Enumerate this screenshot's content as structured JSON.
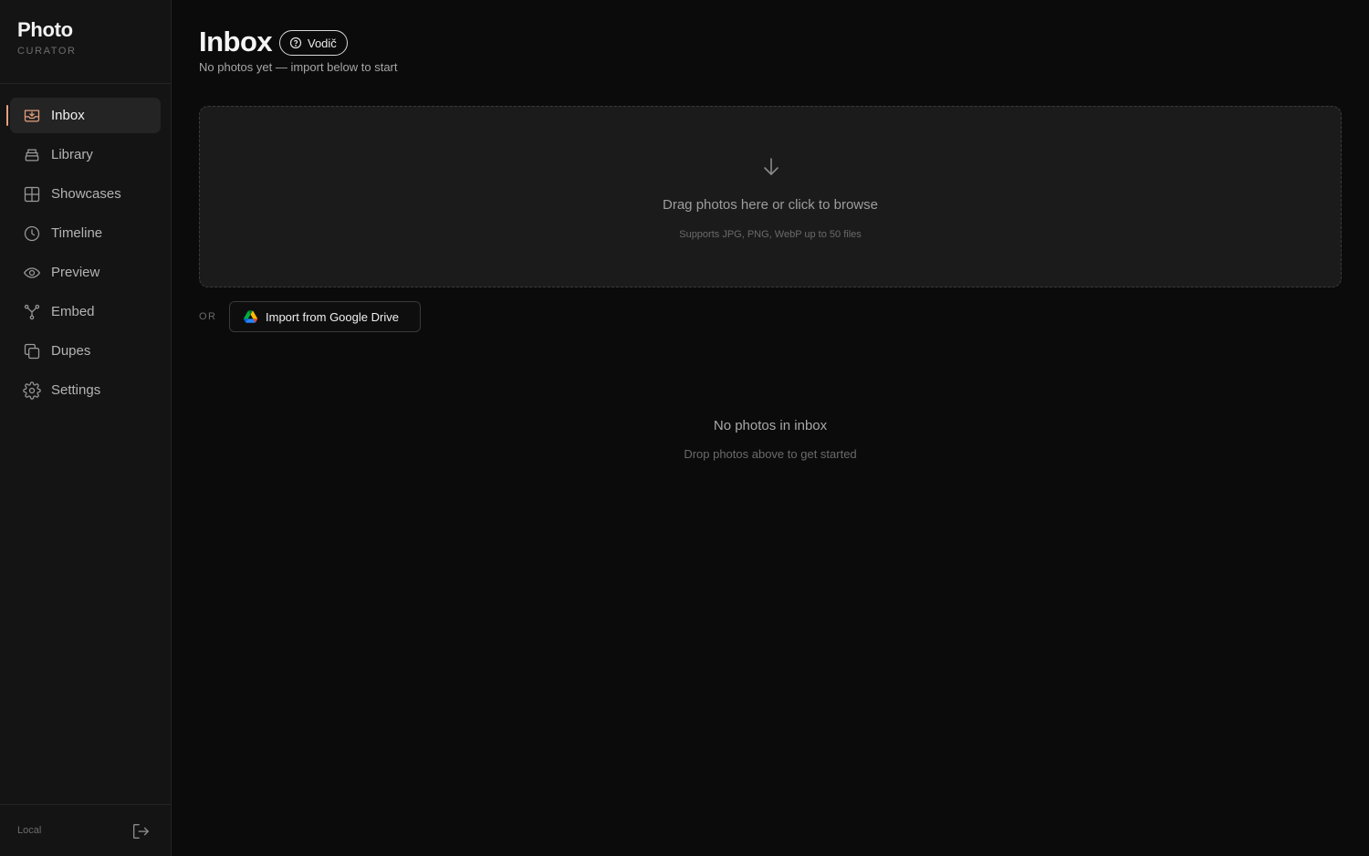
{
  "brand": {
    "title": "Photo",
    "subtitle": "CURATOR"
  },
  "nav": {
    "items": [
      {
        "label": "Inbox",
        "icon": "inbox-icon",
        "active": true
      },
      {
        "label": "Library",
        "icon": "library-icon"
      },
      {
        "label": "Showcases",
        "icon": "grid-icon"
      },
      {
        "label": "Timeline",
        "icon": "clock-icon"
      },
      {
        "label": "Preview",
        "icon": "eye-icon"
      },
      {
        "label": "Embed",
        "icon": "branch-icon"
      },
      {
        "label": "Dupes",
        "icon": "copy-icon"
      },
      {
        "label": "Settings",
        "icon": "gear-icon"
      }
    ]
  },
  "footer": {
    "label": "Local",
    "logout_icon": "logout-icon"
  },
  "header": {
    "title": "Inbox",
    "guide_label": "Vodič",
    "subtitle": "No photos yet — import below to start"
  },
  "dropzone": {
    "main_text": "Drag photos here or click to browse",
    "hint_text": "Supports JPG, PNG, WebP up to 50 files"
  },
  "import": {
    "or_label": "OR",
    "gdrive_label": "Import from Google Drive"
  },
  "empty": {
    "title": "No photos in inbox",
    "subtitle": "Drop photos above to get started"
  },
  "colors": {
    "accent": "#e8a07d",
    "background": "#0b0b0b",
    "sidebar": "#141414",
    "dropzone": "#1b1b1b"
  }
}
